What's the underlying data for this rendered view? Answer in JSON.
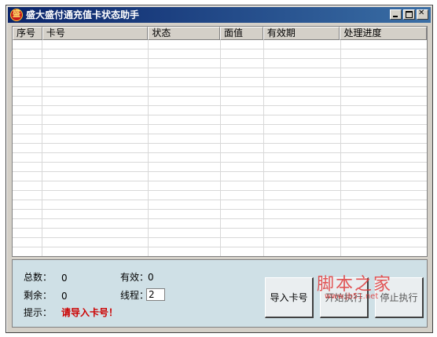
{
  "window": {
    "title": "盛大盛付通充值卡状态助手",
    "icon": "app-logo-icon",
    "controls": [
      "minimize-icon",
      "maximize-icon",
      "close-icon"
    ]
  },
  "table": {
    "columns": [
      "序号",
      "卡号",
      "状态",
      "面值",
      "有效期",
      "处理进度"
    ],
    "rows": []
  },
  "stats": {
    "total_label": "总数：",
    "total_value": "0",
    "valid_label": "有效：",
    "valid_value": "0",
    "remaining_label": "剩余：",
    "remaining_value": "0",
    "threads_label": "线程：",
    "threads_value": "2",
    "hint_label": "提示：",
    "hint_value": "请导入卡号！"
  },
  "buttons": {
    "import": "导入卡号",
    "start": "开始执行",
    "stop": "停止执行"
  },
  "watermark": {
    "text": "脚本之家",
    "url": "www.jb51.net"
  },
  "colors": {
    "titlebar": "#0a246a",
    "panel_bg": "#cfe0e6",
    "hint": "#cc0000",
    "watermark": "#e03a3a"
  }
}
